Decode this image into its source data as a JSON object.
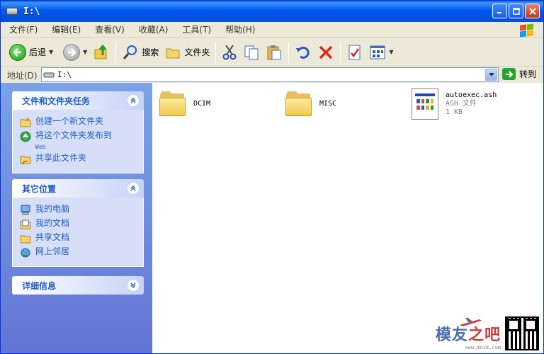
{
  "window": {
    "title": "I:\\"
  },
  "menu": [
    "文件(F)",
    "编辑(E)",
    "查看(V)",
    "收藏(A)",
    "工具(T)",
    "帮助(H)"
  ],
  "toolbar": {
    "back_label": "后退",
    "search_label": "搜索",
    "folders_label": "文件夹"
  },
  "address": {
    "label": "地址(D)",
    "value": "I:\\",
    "go_label": "转到"
  },
  "panels": {
    "file_tasks": {
      "title": "文件和文件夹任务",
      "items": [
        {
          "label": "创建一个新文件夹",
          "icon": "new-folder-icon"
        },
        {
          "label": "将这个文件夹发布到",
          "sub": "Web",
          "icon": "publish-web-icon"
        },
        {
          "label": "共享此文件夹",
          "icon": "share-folder-icon"
        }
      ]
    },
    "other_places": {
      "title": "其它位置",
      "items": [
        {
          "label": "我的电脑",
          "icon": "my-computer-icon"
        },
        {
          "label": "我的文档",
          "icon": "my-documents-icon"
        },
        {
          "label": "共享文档",
          "icon": "shared-documents-icon"
        },
        {
          "label": "网上邻居",
          "icon": "network-places-icon"
        }
      ]
    },
    "details": {
      "title": "详细信息"
    }
  },
  "files": [
    {
      "name": "DCIM",
      "type": "folder"
    },
    {
      "name": "MISC",
      "type": "folder"
    },
    {
      "name": "autoexec.ash",
      "kind": "ASH 文件",
      "size": "1 KB",
      "type": "file"
    }
  ],
  "watermark": {
    "brand_a": "模友",
    "brand_b": "之吧",
    "url": "www.moz8.com"
  },
  "colors": {
    "title_bar": "#0058ee",
    "task_pane": "#7ba2e7",
    "panel_title": "#215dc6",
    "link": "#215dc6"
  }
}
